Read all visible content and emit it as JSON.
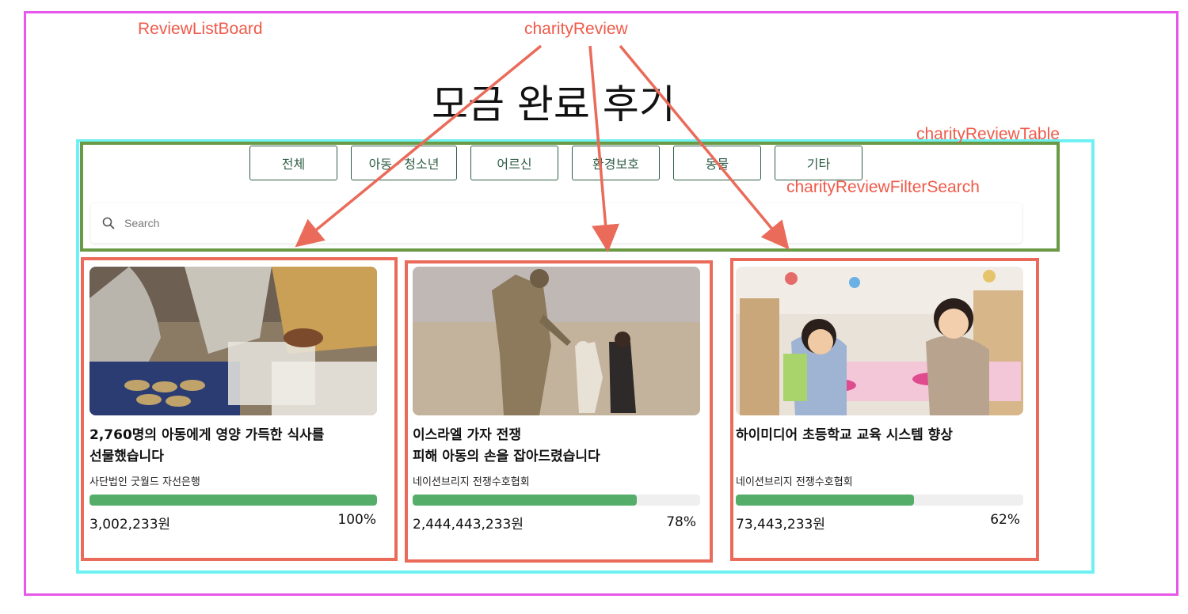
{
  "annotations": {
    "board_label": "ReviewListBoard",
    "review_label": "charityReview",
    "table_label": "charityReviewTable",
    "filter_search_label": "charityReviewFilterSearch"
  },
  "colors": {
    "board_outline": "#e657ea",
    "table_outline": "#6ff0f3",
    "filter_outline": "#6a9a45",
    "card_outline": "#ea6b5a",
    "annotation_text": "#ef5a4a",
    "progress_fill": "#55ad6a",
    "button_border": "#2f5e46"
  },
  "page": {
    "title": "모금 완료 후기"
  },
  "filters": [
    "전체",
    "아동 · 청소년",
    "어르신",
    "환경보호",
    "동물",
    "기타"
  ],
  "search": {
    "placeholder": "Search",
    "icon": "search-icon"
  },
  "reviews": [
    {
      "title": "2,760명의 아동에게 영양 가득한 식사를\n선물했습니다",
      "organization": "사단법인 굿월드 자선은행",
      "amount": "3,002,233원",
      "percent_label": "100%",
      "progress": 1.0,
      "image": "food-distribution-photo"
    },
    {
      "title": "이스라엘 가자 전쟁\n피해 아동의 손을 잡아드렸습니다",
      "organization": "네이션브리지 전쟁수호협회",
      "amount": "2,444,443,233원",
      "percent_label": "78%",
      "progress": 0.78,
      "image": "soldier-and-children-photo"
    },
    {
      "title": "하이미디어 초등학교 교육 시스템 향상",
      "organization": "네이션브리지 전쟁수호협회",
      "amount": "73,443,233원",
      "percent_label": "62%",
      "progress": 0.62,
      "image": "classroom-children-photo"
    }
  ]
}
